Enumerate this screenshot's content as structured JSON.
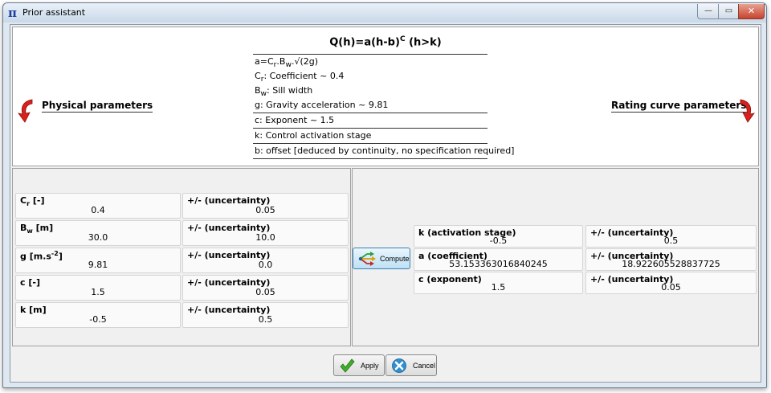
{
  "window": {
    "title": "Prior assistant",
    "app_icon_glyph": "π",
    "minimize_glyph": "—",
    "maximize_glyph": "▭",
    "close_glyph": "✕"
  },
  "header": {
    "formula_main": "Q(h)=a(h-b)",
    "formula_sup": "C",
    "formula_tail": " (h>k)",
    "definitions": {
      "a_prefix": "a=C",
      "a_sub1": "r",
      "a_mid": ".B",
      "a_sub2": "w",
      "a_suffix": ".√(2g)",
      "cr_sym": "C",
      "cr_sub": "r",
      "cr_text": ": Coefficient ~ 0.4",
      "bw_sym": "B",
      "bw_sub": "w",
      "bw_text": ": Sill width",
      "g_text": "g: Gravity acceleration ~ 9.81",
      "c_text": "c: Exponent ~ 1.5",
      "k_text": "k: Control activation stage",
      "b_text": "b: offset [deduced by continuity, no specification required]"
    },
    "physical_title": "Physical parameters",
    "rating_title": "Rating curve parameters"
  },
  "physical": {
    "unc_label": "+/- (uncertainty)",
    "cr": {
      "sym": "C",
      "sub": "r",
      "unit": " [-]",
      "value": "0.4",
      "unc": "0.05"
    },
    "bw": {
      "sym": "B",
      "sub": "w",
      "unit": " [m]",
      "value": "30.0",
      "unc": "10.0"
    },
    "g": {
      "label": "g [m.s",
      "sup": "-2",
      "close": "]",
      "value": "9.81",
      "unc": "0.0"
    },
    "c": {
      "label": "c [-]",
      "value": "1.5",
      "unc": "0.05"
    },
    "k": {
      "label": "k [m]",
      "value": "-0.5",
      "unc": "0.5"
    }
  },
  "rating": {
    "compute_label": "Compute",
    "unc_label": "+/- (uncertainty)",
    "k": {
      "label": "k (activation stage)",
      "value": "-0.5",
      "unc": "0.5"
    },
    "a": {
      "label": "a (coefficient)",
      "value": "53.153363016840245",
      "unc": "18.922605528837725"
    },
    "c": {
      "label": "c (exponent)",
      "value": "1.5",
      "unc": "0.05"
    }
  },
  "buttons": {
    "apply_label": "Apply",
    "cancel_label": "Cancel"
  },
  "colors": {
    "arrow_red": "#d9201b",
    "apply_green": "#3fae2a",
    "cancel_blue": "#2f8fd1"
  }
}
